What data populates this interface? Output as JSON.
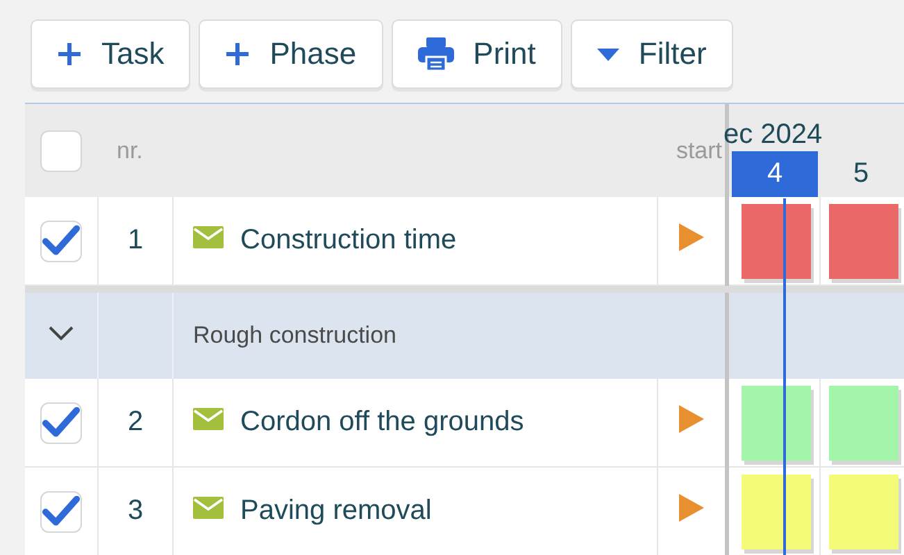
{
  "toolbar": [
    {
      "kind": "add",
      "label": "Task"
    },
    {
      "kind": "add",
      "label": "Phase"
    },
    {
      "kind": "print",
      "label": "Print"
    },
    {
      "kind": "filter",
      "label": "Filter"
    }
  ],
  "header": {
    "select_all_checked": false,
    "nr": "nr.",
    "start": "start"
  },
  "timeline": {
    "month": "ec 2024",
    "days": [
      {
        "label": "4",
        "selected": true
      },
      {
        "label": "5",
        "selected": false
      }
    ]
  },
  "rows": [
    {
      "kind": "task",
      "checked": true,
      "nr": "1",
      "name": "Construction time",
      "color": "#ea6868"
    },
    {
      "kind": "phase",
      "expanded": true,
      "name": "Rough construction"
    },
    {
      "kind": "task",
      "checked": true,
      "nr": "2",
      "name": "Cordon off the grounds",
      "color": "#a2f5a9"
    },
    {
      "kind": "task",
      "checked": true,
      "nr": "3",
      "name": "Paving removal",
      "color": "#f3fb78"
    }
  ]
}
